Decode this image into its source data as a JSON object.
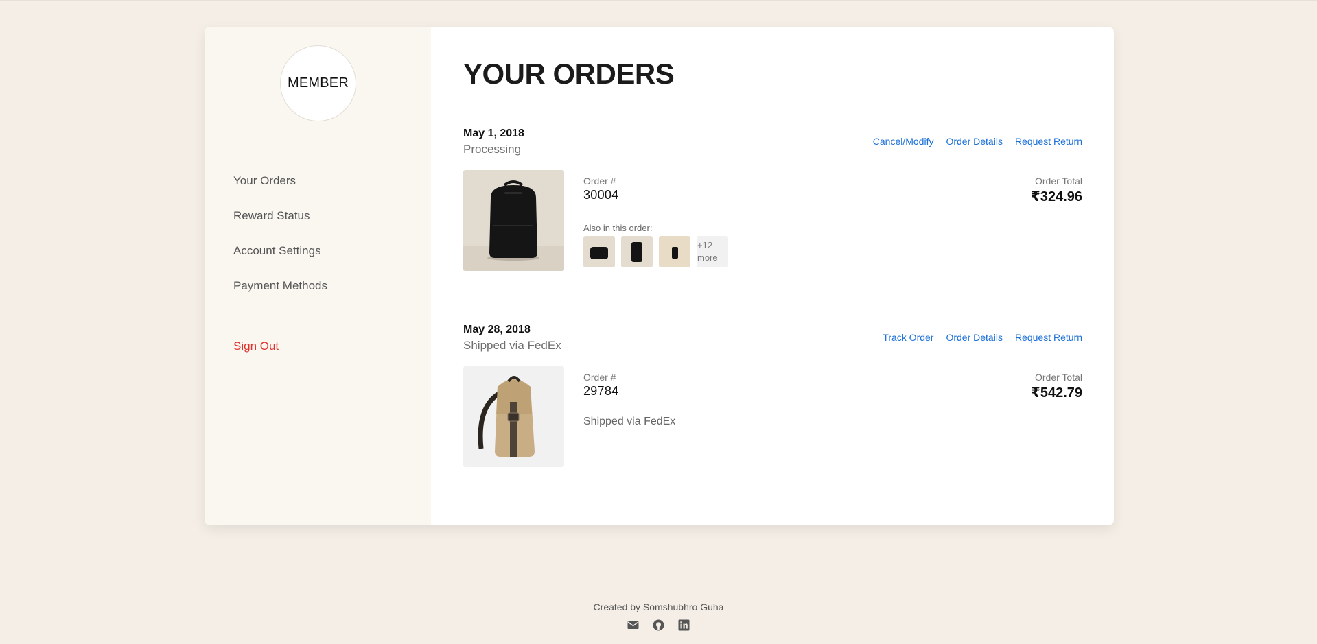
{
  "sidebar": {
    "avatar_text": "MEMBER",
    "nav": [
      {
        "label": "Your Orders"
      },
      {
        "label": "Reward Status"
      },
      {
        "label": "Account Settings"
      },
      {
        "label": "Payment Methods"
      }
    ],
    "signout": "Sign Out"
  },
  "main": {
    "title": "YOUR ORDERS",
    "orders": [
      {
        "date": "May 1, 2018",
        "status": "Processing",
        "actions": [
          "Cancel/Modify",
          "Order Details",
          "Request Return"
        ],
        "order_label": "Order #",
        "order_number": "30004",
        "total_label": "Order Total",
        "total": "₹324.96",
        "also_label": "Also in this order:",
        "more_label": "+12 more"
      },
      {
        "date": "May 28, 2018",
        "status": "Shipped via FedEx",
        "actions": [
          "Track Order",
          "Order Details",
          "Request Return"
        ],
        "order_label": "Order #",
        "order_number": "29784",
        "total_label": "Order Total",
        "total": "₹542.79",
        "shipping_note": "Shipped via FedEx"
      }
    ]
  },
  "footer": {
    "credit": "Created by Somshubhro Guha",
    "icons": [
      "mail-icon",
      "github-icon",
      "linkedin-icon"
    ]
  },
  "colors": {
    "background": "#f4eee6",
    "sidebar": "#faf7f1",
    "link": "#1a6fd8",
    "signout": "#e0312c"
  }
}
